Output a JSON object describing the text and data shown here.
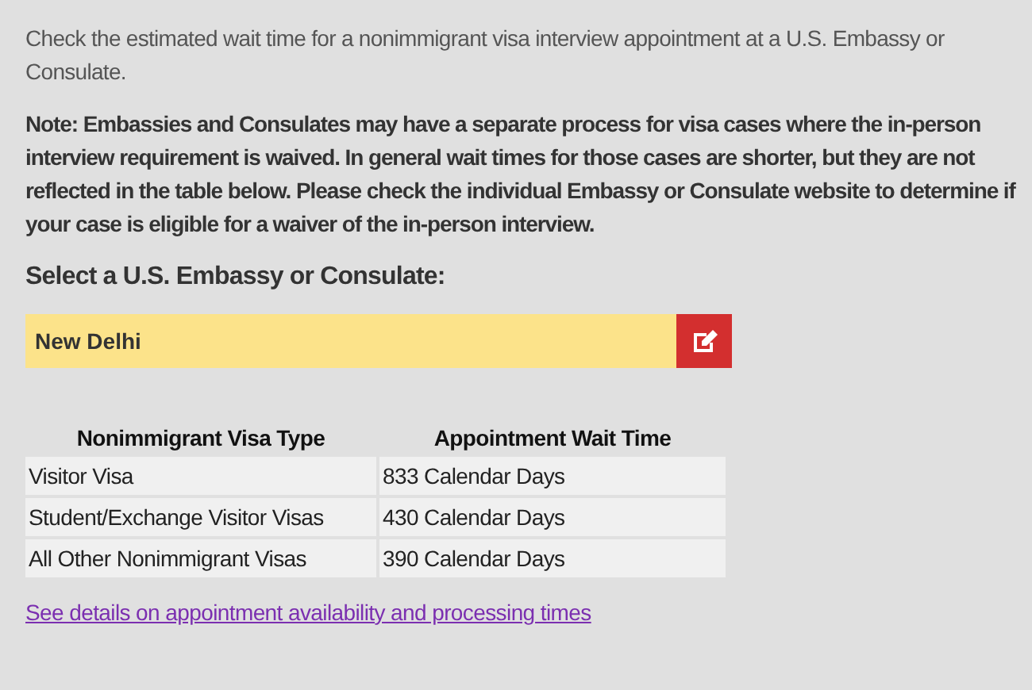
{
  "intro": "Check the estimated wait time for a nonimmigrant visa interview appointment at a U.S. Embassy or Consulate.",
  "note": "Note: Embassies and Consulates may have a separate process for visa cases where the in-person interview requirement is waived.  In general wait times for those cases are shorter, but they are not reflected in the table below.  Please check the individual Embassy or Consulate website to determine if your case is eligible for a waiver of the in-person interview.",
  "select_label": "Select a U.S. Embassy or Consulate:",
  "selected_post": "New Delhi",
  "table": {
    "columns": [
      "Nonimmigrant Visa Type",
      "Appointment Wait Time"
    ],
    "rows": [
      [
        "Visitor Visa",
        "833 Calendar Days"
      ],
      [
        "Student/Exchange Visitor Visas",
        "430 Calendar Days"
      ],
      [
        "All Other Nonimmigrant Visas",
        "390 Calendar Days"
      ]
    ]
  },
  "link": "See details on appointment availability and processing times"
}
